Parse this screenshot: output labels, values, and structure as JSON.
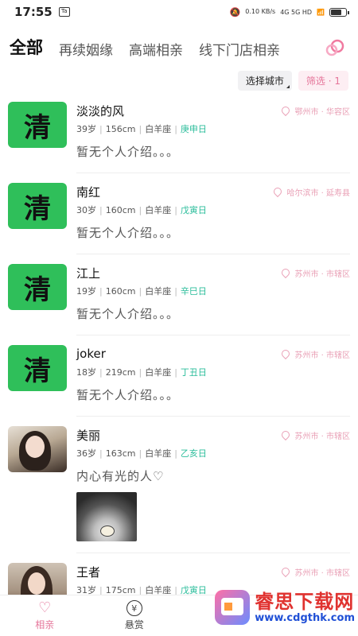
{
  "status": {
    "time": "17:55",
    "app_badge": "Ta",
    "net_speed": "0.10 KB/s",
    "signal": "4G 5G HD"
  },
  "tabs": [
    {
      "label": "全部",
      "active": true
    },
    {
      "label": "再续姻缘",
      "active": false
    },
    {
      "label": "高端相亲",
      "active": false
    },
    {
      "label": "线下门店相亲",
      "active": false
    }
  ],
  "filter": {
    "city_label": "选择城市",
    "filter_label": "筛选 · 1"
  },
  "profiles": [
    {
      "name": "淡淡的风",
      "age": "39岁",
      "height": "156cm",
      "sign": "白羊座",
      "day": "庚申日",
      "location": "鄂州市 · 华容区",
      "intro": "暂无个人介绍。。。",
      "avatar": "qing",
      "avatar_text": "清"
    },
    {
      "name": "南红",
      "age": "30岁",
      "height": "160cm",
      "sign": "白羊座",
      "day": "戊寅日",
      "location": "哈尔滨市 · 延寿县",
      "intro": "暂无个人介绍。。。",
      "avatar": "qing",
      "avatar_text": "清"
    },
    {
      "name": "江上",
      "age": "19岁",
      "height": "160cm",
      "sign": "白羊座",
      "day": "辛巳日",
      "location": "苏州市 · 市辖区",
      "intro": "暂无个人介绍。。。",
      "avatar": "qing",
      "avatar_text": "清"
    },
    {
      "name": "joker",
      "age": "18岁",
      "height": "219cm",
      "sign": "白羊座",
      "day": "丁丑日",
      "location": "苏州市 · 市辖区",
      "intro": "暂无个人介绍。。。",
      "avatar": "qing",
      "avatar_text": "清"
    },
    {
      "name": "美丽",
      "age": "36岁",
      "height": "163cm",
      "sign": "白羊座",
      "day": "乙亥日",
      "location": "苏州市 · 市辖区",
      "intro": "内心有光的人♡",
      "avatar": "photo",
      "has_post_image": true
    },
    {
      "name": "王者",
      "age": "31岁",
      "height": "175cm",
      "sign": "白羊座",
      "day": "戊寅日",
      "location": "苏州市 · 市辖区",
      "intro": "",
      "avatar": "photo2"
    }
  ],
  "nav": [
    {
      "label": "相亲",
      "icon": "heart-icon",
      "active": true
    },
    {
      "label": "悬赏",
      "icon": "yen-coin-icon",
      "active": false
    }
  ],
  "watermark": {
    "title": "睿思下载网",
    "url": "www.cdgthk.com"
  },
  "colors": {
    "accent_pink": "#e5759a",
    "day_teal": "#2bbd9b",
    "avatar_green": "#2fbf5a"
  }
}
